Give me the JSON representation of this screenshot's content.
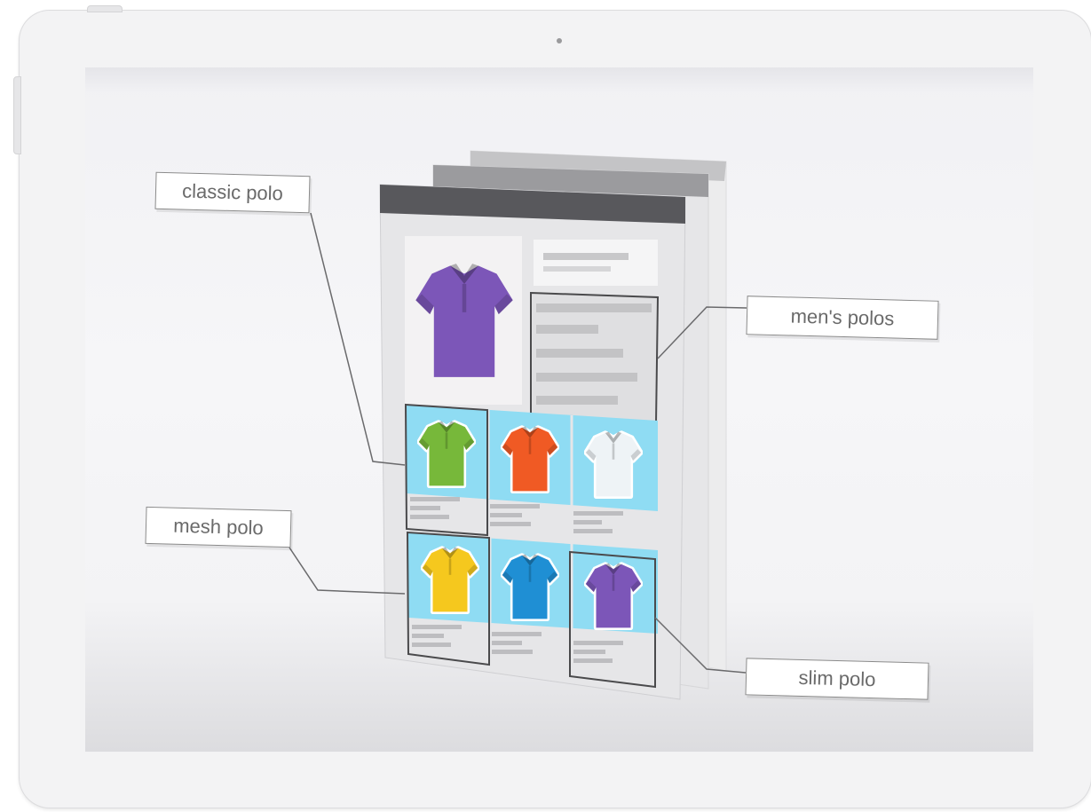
{
  "labels": {
    "classic": "classic polo",
    "mens": "men's polos",
    "mesh": "mesh polo",
    "slim": "slim polo"
  },
  "icons": [
    "shirt-icon-purple-large",
    "shirt-icon-green",
    "shirt-icon-red",
    "shirt-icon-white",
    "shirt-icon-yellow",
    "shirt-icon-blue",
    "shirt-icon-purple"
  ],
  "colors": {
    "purple": "#7c56b8",
    "green": "#77b83a",
    "red": "#f05a24",
    "white": "#eef3f6",
    "yellow": "#f5c81e",
    "blue": "#1f8fd4",
    "tile_bg": "#8fdcf3",
    "header_bar": "#58585c"
  }
}
